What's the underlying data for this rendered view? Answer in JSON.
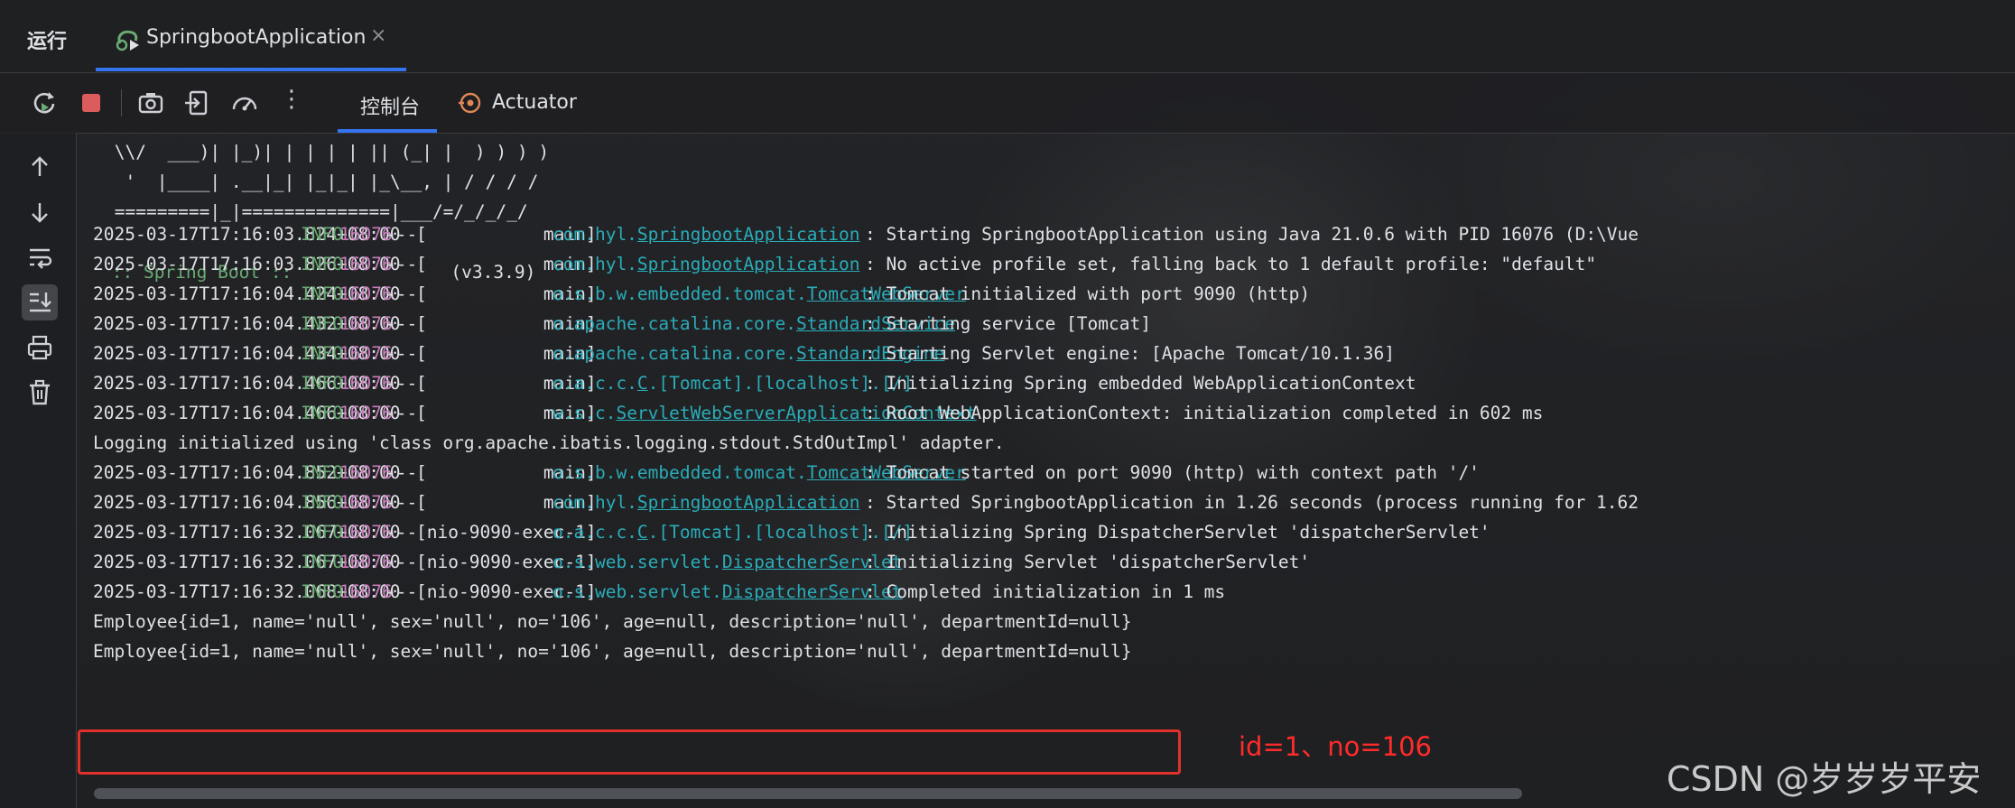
{
  "run_panel": {
    "title": "运行",
    "tab_label": "SpringbootApplication",
    "tab_close": "×"
  },
  "toolbar": {
    "icons": [
      "rerun-icon",
      "stop-icon",
      "screenshot-icon",
      "exit-icon",
      "profiler-icon",
      "more-icon"
    ],
    "more_glyph": "⋮",
    "tabs": [
      {
        "label": "控制台",
        "active": true
      },
      {
        "label": "Actuator",
        "active": false
      }
    ]
  },
  "gutter": {
    "icons": [
      "scroll-up-icon",
      "scroll-down-icon",
      "soft-wrap-icon",
      "scroll-to-end-icon",
      "print-icon",
      "clear-icon"
    ]
  },
  "console": {
    "banner": [
      " \\\\/  ___)| |_)| | | | | || (_| |  ) ) ) )",
      "  '  |____| .__|_| |_|_| |_\\__, | / / / /",
      " =========|_|==============|___/=/_/_/_/"
    ],
    "spring_boot_label": " :: Spring Boot :: ",
    "spring_boot_version": "              (v3.3.9)",
    "log_lines": [
      {
        "ts": "2025-03-17T17:16:03.824+08:00",
        "level": "INFO",
        "pid": "16076",
        "sep": "---",
        "thread": "[           main]",
        "logger_prefix": "com.hyl.",
        "logger_class": "SpringbootApplication",
        "message": ": Starting SpringbootApplication using Java 21.0.6 with PID 16076 (D:\\Vue"
      },
      {
        "ts": "2025-03-17T17:16:03.826+08:00",
        "level": "INFO",
        "pid": "16076",
        "sep": "---",
        "thread": "[           main]",
        "logger_prefix": "com.hyl.",
        "logger_class": "SpringbootApplication",
        "message": ": No active profile set, falling back to 1 default profile: \"default\""
      },
      {
        "ts": "2025-03-17T17:16:04.424+08:00",
        "level": "INFO",
        "pid": "16076",
        "sep": "---",
        "thread": "[           main]",
        "logger_prefix": "o.s.b.w.embedded.tomcat.",
        "logger_class": "TomcatWebServer",
        "message": ": Tomcat initialized with port 9090 (http)"
      },
      {
        "ts": "2025-03-17T17:16:04.432+08:00",
        "level": "INFO",
        "pid": "16076",
        "sep": "---",
        "thread": "[           main]",
        "logger_prefix": "o.apache.catalina.core.",
        "logger_class": "StandardService",
        "message": ": Starting service [Tomcat]"
      },
      {
        "ts": "2025-03-17T17:16:04.434+08:00",
        "level": "INFO",
        "pid": "16076",
        "sep": "---",
        "thread": "[           main]",
        "logger_prefix": "o.apache.catalina.core.",
        "logger_class": "StandardEngine",
        "message": ": Starting Servlet engine: [Apache Tomcat/10.1.36]"
      },
      {
        "ts": "2025-03-17T17:16:04.466+08:00",
        "level": "INFO",
        "pid": "16076",
        "sep": "---",
        "thread": "[           main]",
        "logger_prefix": "o.a.c.c.",
        "logger_class": "C",
        "logger_suffix": ".[Tomcat].[localhost].[/]",
        "message": ": Initializing Spring embedded WebApplicationContext"
      },
      {
        "ts": "2025-03-17T17:16:04.466+08:00",
        "level": "INFO",
        "pid": "16076",
        "sep": "---",
        "thread": "[           main]",
        "logger_prefix": "w.s.c.",
        "logger_class": "ServletWebServerApplicationContext",
        "message": ": Root WebApplicationContext: initialization completed in 602 ms"
      },
      {
        "plain": "Logging initialized using 'class org.apache.ibatis.logging.stdout.StdOutImpl' adapter."
      },
      {
        "ts": "2025-03-17T17:16:04.852+08:00",
        "level": "INFO",
        "pid": "16076",
        "sep": "---",
        "thread": "[           main]",
        "logger_prefix": "o.s.b.w.embedded.tomcat.",
        "logger_class": "TomcatWebServer",
        "message": ": Tomcat started on port 9090 (http) with context path '/'"
      },
      {
        "ts": "2025-03-17T17:16:04.856+08:00",
        "level": "INFO",
        "pid": "16076",
        "sep": "---",
        "thread": "[           main]",
        "logger_prefix": "com.hyl.",
        "logger_class": "SpringbootApplication",
        "message": ": Started SpringbootApplication in 1.26 seconds (process running for 1.62"
      },
      {
        "ts": "2025-03-17T17:16:32.067+08:00",
        "level": "INFO",
        "pid": "16076",
        "sep": "---",
        "thread": "[nio-9090-exec-1]",
        "logger_prefix": "o.a.c.c.",
        "logger_class": "C",
        "logger_suffix": ".[Tomcat].[localhost].[/]",
        "message": ": Initializing Spring DispatcherServlet 'dispatcherServlet'"
      },
      {
        "ts": "2025-03-17T17:16:32.067+08:00",
        "level": "INFO",
        "pid": "16076",
        "sep": "---",
        "thread": "[nio-9090-exec-1]",
        "logger_prefix": "o.s.web.servlet.",
        "logger_class": "DispatcherServlet",
        "message": ": Initializing Servlet 'dispatcherServlet'"
      },
      {
        "ts": "2025-03-17T17:16:32.068+08:00",
        "level": "INFO",
        "pid": "16076",
        "sep": "---",
        "thread": "[nio-9090-exec-1]",
        "logger_prefix": "o.s.web.servlet.",
        "logger_class": "DispatcherServlet",
        "message": ": Completed initialization in 1 ms"
      },
      {
        "plain": "Employee{id=1, name='null', sex='null', no='106', age=null, description='null', departmentId=null}"
      },
      {
        "plain": "Employee{id=1, name='null', sex='null', no='106', age=null, description='null', departmentId=null}"
      }
    ]
  },
  "annotation": "id=1、no=106",
  "watermark": "CSDN @岁岁岁平安",
  "colors": {
    "background": "#1e1f22",
    "accent": "#3574f0",
    "info_green": "#6aab73",
    "pid_purple": "#c77dbb",
    "logger_cyan": "#2aacb8",
    "highlight_red": "#e0312c"
  }
}
